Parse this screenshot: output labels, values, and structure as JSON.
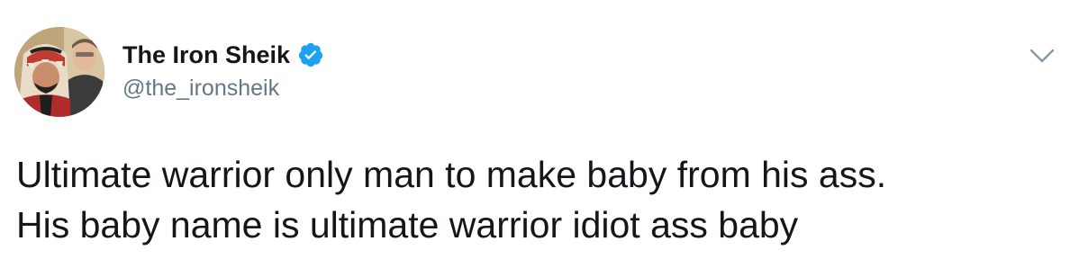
{
  "tweet": {
    "author": {
      "display_name": "The Iron Sheik",
      "handle": "@the_ironsheik",
      "verified": true,
      "avatar_icon": "profile-photo"
    },
    "menu_icon": "chevron-down-icon",
    "text_lines": [
      "Ultimate warrior only man to make baby from his ass.",
      "His baby name is ultimate warrior idiot ass baby"
    ]
  },
  "colors": {
    "text": "#14171a",
    "secondary_text": "#657786",
    "verified_blue": "#1da1f2",
    "caret": "#8899a6"
  }
}
